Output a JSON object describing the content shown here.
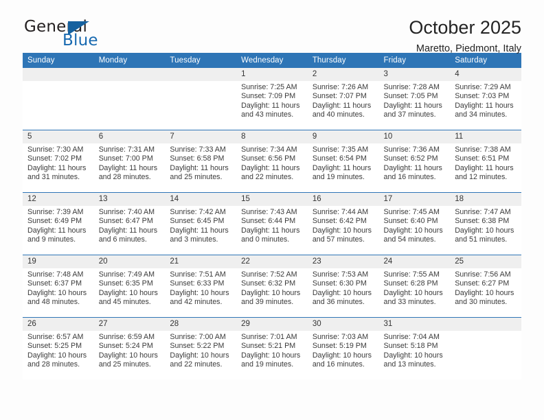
{
  "brand": {
    "name_part1": "General",
    "name_part2": "Blue",
    "triangle_color": "#15619f"
  },
  "header": {
    "title": "October 2025",
    "subtitle": "Maretto, Piedmont, Italy",
    "header_bg": "#2e75b6",
    "daynum_bg": "#efefef"
  },
  "weekdays": [
    "Sunday",
    "Monday",
    "Tuesday",
    "Wednesday",
    "Thursday",
    "Friday",
    "Saturday"
  ],
  "weeks": [
    [
      {
        "day": "",
        "sunrise": "",
        "sunset": "",
        "daylight1": "",
        "daylight2": ""
      },
      {
        "day": "",
        "sunrise": "",
        "sunset": "",
        "daylight1": "",
        "daylight2": ""
      },
      {
        "day": "",
        "sunrise": "",
        "sunset": "",
        "daylight1": "",
        "daylight2": ""
      },
      {
        "day": "1",
        "sunrise": "Sunrise: 7:25 AM",
        "sunset": "Sunset: 7:09 PM",
        "daylight1": "Daylight: 11 hours",
        "daylight2": "and 43 minutes."
      },
      {
        "day": "2",
        "sunrise": "Sunrise: 7:26 AM",
        "sunset": "Sunset: 7:07 PM",
        "daylight1": "Daylight: 11 hours",
        "daylight2": "and 40 minutes."
      },
      {
        "day": "3",
        "sunrise": "Sunrise: 7:28 AM",
        "sunset": "Sunset: 7:05 PM",
        "daylight1": "Daylight: 11 hours",
        "daylight2": "and 37 minutes."
      },
      {
        "day": "4",
        "sunrise": "Sunrise: 7:29 AM",
        "sunset": "Sunset: 7:03 PM",
        "daylight1": "Daylight: 11 hours",
        "daylight2": "and 34 minutes."
      }
    ],
    [
      {
        "day": "5",
        "sunrise": "Sunrise: 7:30 AM",
        "sunset": "Sunset: 7:02 PM",
        "daylight1": "Daylight: 11 hours",
        "daylight2": "and 31 minutes."
      },
      {
        "day": "6",
        "sunrise": "Sunrise: 7:31 AM",
        "sunset": "Sunset: 7:00 PM",
        "daylight1": "Daylight: 11 hours",
        "daylight2": "and 28 minutes."
      },
      {
        "day": "7",
        "sunrise": "Sunrise: 7:33 AM",
        "sunset": "Sunset: 6:58 PM",
        "daylight1": "Daylight: 11 hours",
        "daylight2": "and 25 minutes."
      },
      {
        "day": "8",
        "sunrise": "Sunrise: 7:34 AM",
        "sunset": "Sunset: 6:56 PM",
        "daylight1": "Daylight: 11 hours",
        "daylight2": "and 22 minutes."
      },
      {
        "day": "9",
        "sunrise": "Sunrise: 7:35 AM",
        "sunset": "Sunset: 6:54 PM",
        "daylight1": "Daylight: 11 hours",
        "daylight2": "and 19 minutes."
      },
      {
        "day": "10",
        "sunrise": "Sunrise: 7:36 AM",
        "sunset": "Sunset: 6:52 PM",
        "daylight1": "Daylight: 11 hours",
        "daylight2": "and 16 minutes."
      },
      {
        "day": "11",
        "sunrise": "Sunrise: 7:38 AM",
        "sunset": "Sunset: 6:51 PM",
        "daylight1": "Daylight: 11 hours",
        "daylight2": "and 12 minutes."
      }
    ],
    [
      {
        "day": "12",
        "sunrise": "Sunrise: 7:39 AM",
        "sunset": "Sunset: 6:49 PM",
        "daylight1": "Daylight: 11 hours",
        "daylight2": "and 9 minutes."
      },
      {
        "day": "13",
        "sunrise": "Sunrise: 7:40 AM",
        "sunset": "Sunset: 6:47 PM",
        "daylight1": "Daylight: 11 hours",
        "daylight2": "and 6 minutes."
      },
      {
        "day": "14",
        "sunrise": "Sunrise: 7:42 AM",
        "sunset": "Sunset: 6:45 PM",
        "daylight1": "Daylight: 11 hours",
        "daylight2": "and 3 minutes."
      },
      {
        "day": "15",
        "sunrise": "Sunrise: 7:43 AM",
        "sunset": "Sunset: 6:44 PM",
        "daylight1": "Daylight: 11 hours",
        "daylight2": "and 0 minutes."
      },
      {
        "day": "16",
        "sunrise": "Sunrise: 7:44 AM",
        "sunset": "Sunset: 6:42 PM",
        "daylight1": "Daylight: 10 hours",
        "daylight2": "and 57 minutes."
      },
      {
        "day": "17",
        "sunrise": "Sunrise: 7:45 AM",
        "sunset": "Sunset: 6:40 PM",
        "daylight1": "Daylight: 10 hours",
        "daylight2": "and 54 minutes."
      },
      {
        "day": "18",
        "sunrise": "Sunrise: 7:47 AM",
        "sunset": "Sunset: 6:38 PM",
        "daylight1": "Daylight: 10 hours",
        "daylight2": "and 51 minutes."
      }
    ],
    [
      {
        "day": "19",
        "sunrise": "Sunrise: 7:48 AM",
        "sunset": "Sunset: 6:37 PM",
        "daylight1": "Daylight: 10 hours",
        "daylight2": "and 48 minutes."
      },
      {
        "day": "20",
        "sunrise": "Sunrise: 7:49 AM",
        "sunset": "Sunset: 6:35 PM",
        "daylight1": "Daylight: 10 hours",
        "daylight2": "and 45 minutes."
      },
      {
        "day": "21",
        "sunrise": "Sunrise: 7:51 AM",
        "sunset": "Sunset: 6:33 PM",
        "daylight1": "Daylight: 10 hours",
        "daylight2": "and 42 minutes."
      },
      {
        "day": "22",
        "sunrise": "Sunrise: 7:52 AM",
        "sunset": "Sunset: 6:32 PM",
        "daylight1": "Daylight: 10 hours",
        "daylight2": "and 39 minutes."
      },
      {
        "day": "23",
        "sunrise": "Sunrise: 7:53 AM",
        "sunset": "Sunset: 6:30 PM",
        "daylight1": "Daylight: 10 hours",
        "daylight2": "and 36 minutes."
      },
      {
        "day": "24",
        "sunrise": "Sunrise: 7:55 AM",
        "sunset": "Sunset: 6:28 PM",
        "daylight1": "Daylight: 10 hours",
        "daylight2": "and 33 minutes."
      },
      {
        "day": "25",
        "sunrise": "Sunrise: 7:56 AM",
        "sunset": "Sunset: 6:27 PM",
        "daylight1": "Daylight: 10 hours",
        "daylight2": "and 30 minutes."
      }
    ],
    [
      {
        "day": "26",
        "sunrise": "Sunrise: 6:57 AM",
        "sunset": "Sunset: 5:25 PM",
        "daylight1": "Daylight: 10 hours",
        "daylight2": "and 28 minutes."
      },
      {
        "day": "27",
        "sunrise": "Sunrise: 6:59 AM",
        "sunset": "Sunset: 5:24 PM",
        "daylight1": "Daylight: 10 hours",
        "daylight2": "and 25 minutes."
      },
      {
        "day": "28",
        "sunrise": "Sunrise: 7:00 AM",
        "sunset": "Sunset: 5:22 PM",
        "daylight1": "Daylight: 10 hours",
        "daylight2": "and 22 minutes."
      },
      {
        "day": "29",
        "sunrise": "Sunrise: 7:01 AM",
        "sunset": "Sunset: 5:21 PM",
        "daylight1": "Daylight: 10 hours",
        "daylight2": "and 19 minutes."
      },
      {
        "day": "30",
        "sunrise": "Sunrise: 7:03 AM",
        "sunset": "Sunset: 5:19 PM",
        "daylight1": "Daylight: 10 hours",
        "daylight2": "and 16 minutes."
      },
      {
        "day": "31",
        "sunrise": "Sunrise: 7:04 AM",
        "sunset": "Sunset: 5:18 PM",
        "daylight1": "Daylight: 10 hours",
        "daylight2": "and 13 minutes."
      },
      {
        "day": "",
        "sunrise": "",
        "sunset": "",
        "daylight1": "",
        "daylight2": ""
      }
    ]
  ]
}
